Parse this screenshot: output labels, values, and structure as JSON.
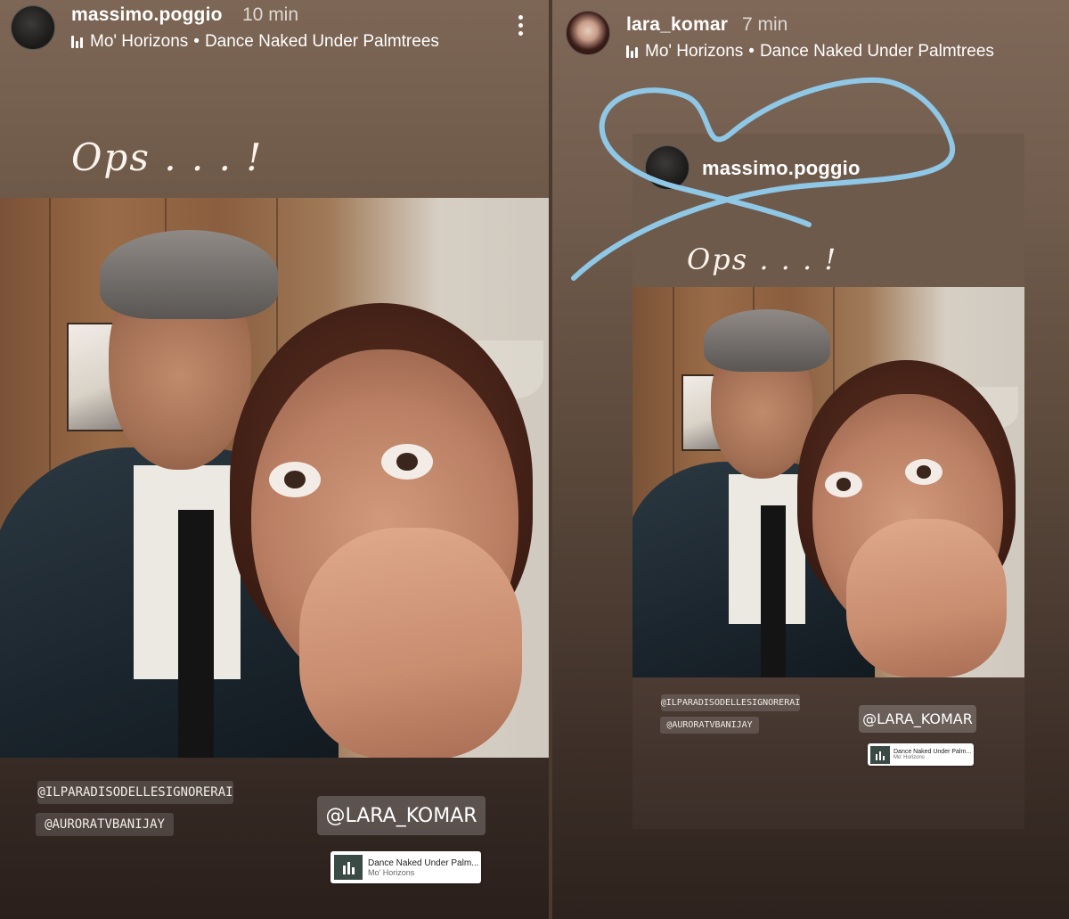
{
  "left_story": {
    "username": "massimo.poggio",
    "time": "10 min",
    "music": {
      "artist": "Mo' Horizons",
      "separator": "•",
      "track": "Dance Naked Under Palmtrees"
    },
    "caption": "Ops . . . !",
    "tags": [
      "@ILPARADISODELLESIGNORERAI",
      "@AURORATVBANIJAY"
    ],
    "mention": "@LARA_KOMAR",
    "music_sticker": {
      "title": "Dance Naked Under Palm...",
      "artist": "Mo' Horizons"
    }
  },
  "right_story": {
    "username": "lara_komar",
    "time": "7 min",
    "music": {
      "artist": "Mo' Horizons",
      "separator": "•",
      "track": "Dance Naked Under Palmtrees"
    },
    "reshared": {
      "username": "massimo.poggio",
      "caption": "Ops . . . !",
      "tags": [
        "@ILPARADISODELLESIGNORERAI",
        "@AURORATVBANIJAY"
      ],
      "mention": "@LARA_KOMAR",
      "music_sticker": {
        "title": "Dance Naked Under Palm...",
        "artist": "Mo' Horizons"
      }
    },
    "doodle_color": "#8fc7e6"
  },
  "icons": {
    "music": "music-bars-icon",
    "more": "more-options-icon"
  }
}
